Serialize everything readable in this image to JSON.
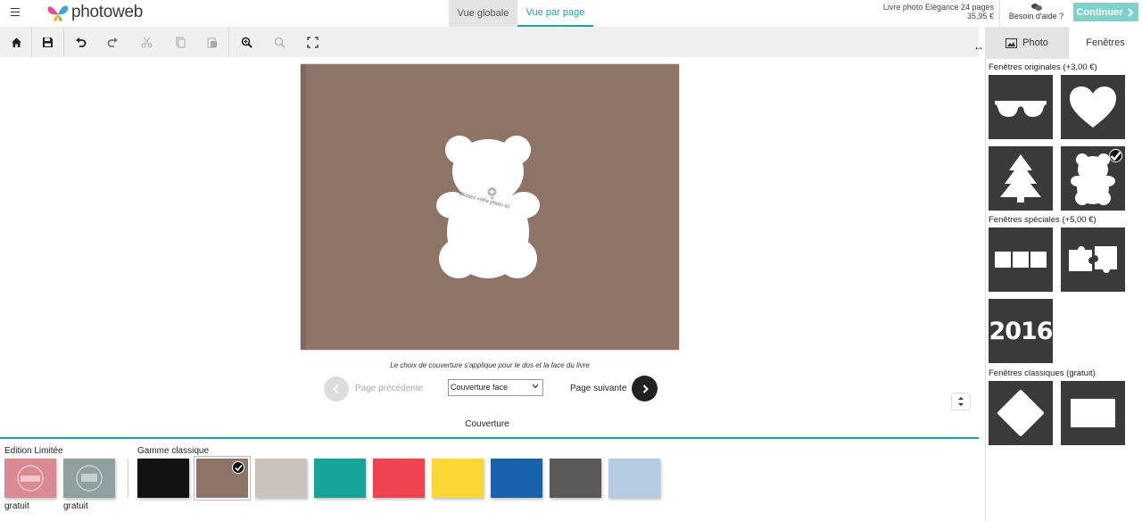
{
  "header": {
    "logo_text": "photoweb",
    "tabs": [
      {
        "label": "Vue globale",
        "active": false
      },
      {
        "label": "Vue par page",
        "active": true
      }
    ],
    "product_name": "Livre photo Elégance 24 pages",
    "product_price": "35,95 €",
    "help_label": "Besoin d'aide ?",
    "continue_label": "Continuer"
  },
  "toolbar": {
    "items": [
      "home-icon",
      "save-icon",
      "undo-icon",
      "redo-icon",
      "cut-icon",
      "copy-icon",
      "paste-icon",
      "zoom-in-icon",
      "zoom-out-icon",
      "fit-screen-icon"
    ]
  },
  "canvas": {
    "book_color": "#8d7466",
    "drop_text": "Glissez votre photo ici",
    "cover_note": "Le choix de couverture s'applique pour le dos et la face du livre"
  },
  "pagination": {
    "prev_label": "Page précédente",
    "next_label": "Page suivante",
    "select_value": "Couverture face",
    "page_name": "Couverture"
  },
  "bottom": {
    "limited_title": "Edition Limitée",
    "classic_title": "Gamme classique",
    "limited_swatches": [
      {
        "color": "#d98a92",
        "price": "gratuit"
      },
      {
        "color": "#8fa0a0",
        "price": "gratuit"
      }
    ],
    "classic_swatches": [
      {
        "color": "#121212",
        "selected": false
      },
      {
        "color": "#8d7466",
        "selected": true
      },
      {
        "color": "#c9c2bd",
        "selected": false
      },
      {
        "color": "#16a598",
        "selected": false
      },
      {
        "color": "#ef4450",
        "selected": false
      },
      {
        "color": "#fbd834",
        "selected": false
      },
      {
        "color": "#1761ad",
        "selected": false
      },
      {
        "color": "#5b5857",
        "selected": false
      },
      {
        "color": "#b5cbe2",
        "selected": false
      }
    ]
  },
  "panel": {
    "tabs": [
      {
        "label": "Photo",
        "icon": "image-icon",
        "active": false
      },
      {
        "label": "Fenêtres",
        "active": true
      }
    ],
    "sections": [
      {
        "title": "Fenêtres originales (+3,00 €)",
        "windows": [
          "sunglasses",
          "heart",
          "tree",
          "bear"
        ]
      },
      {
        "title": "Fenêtres spéciales (+5,00 €)",
        "windows": [
          "three-squares",
          "puzzle",
          "2016"
        ]
      },
      {
        "title": "Fenêtres classiques (gratuit)",
        "windows": [
          "diamond",
          "rectangle"
        ]
      }
    ],
    "selected_window": "bear",
    "year_label": "2016"
  },
  "colors": {
    "accent": "#1aa5a0",
    "continue_bg": "#7dd3cc",
    "window_bg": "#3a3a3a"
  }
}
